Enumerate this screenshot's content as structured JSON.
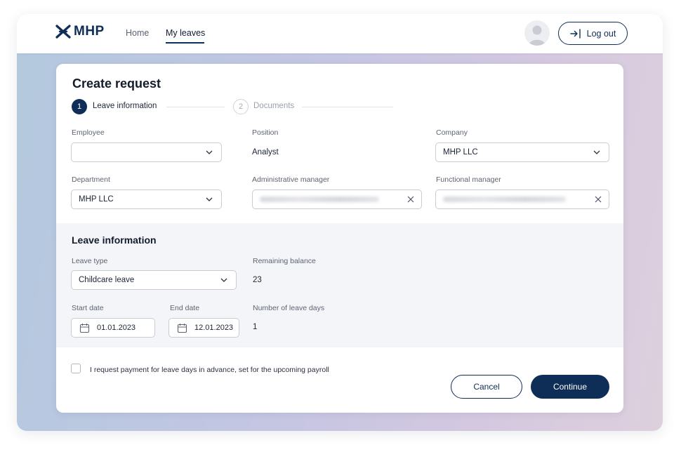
{
  "colors": {
    "brand": "#0e2d57",
    "section_bg": "#f3f5f9",
    "page_bg": "#c2c6e3"
  },
  "header": {
    "logo_text": "MHP",
    "nav": {
      "home": "Home",
      "my_leaves": "My leaves"
    },
    "logout_label": "Log out"
  },
  "form": {
    "title": "Create request",
    "steps": [
      {
        "number": "1",
        "label": "Leave information"
      },
      {
        "number": "2",
        "label": "Documents"
      }
    ],
    "employee": {
      "label": "Employee",
      "value": ""
    },
    "position": {
      "label": "Position",
      "value": "Analyst"
    },
    "company": {
      "label": "Company",
      "value": "MHP LLC"
    },
    "department": {
      "label": "Department",
      "value": "MHP LLC"
    },
    "admin_manager": {
      "label": "Administrative manager"
    },
    "functional_manager": {
      "label": "Functional manager"
    }
  },
  "leave": {
    "section_title": "Leave information",
    "leave_type": {
      "label": "Leave type",
      "value": "Childcare leave"
    },
    "remaining_balance": {
      "label": "Remaining balance",
      "value": "23"
    },
    "start_date": {
      "label": "Start date",
      "value": "01.01.2023"
    },
    "end_date": {
      "label": "End date",
      "value": "12.01.2023"
    },
    "leave_days": {
      "label": "Number of leave days",
      "value": "1"
    }
  },
  "footer": {
    "payment_checkbox_label": "I request payment for leave days in advance, set for the upcoming payroll",
    "cancel_label": "Cancel",
    "continue_label": "Continue"
  },
  "icons": [
    "logo-icon",
    "user-avatar-icon",
    "logout-icon",
    "chevron-down-icon",
    "close-icon",
    "calendar-icon"
  ]
}
